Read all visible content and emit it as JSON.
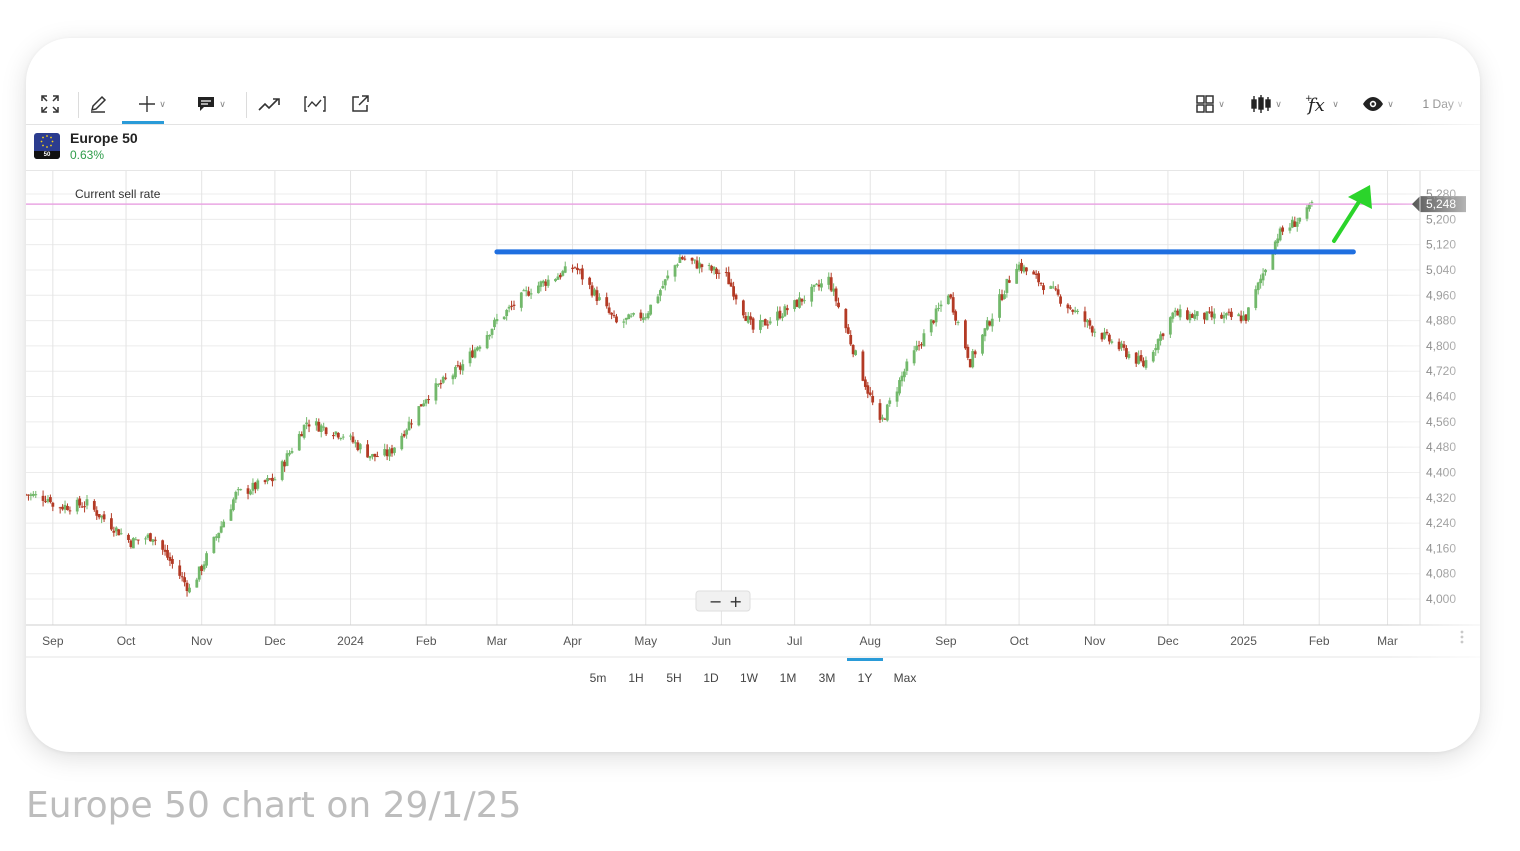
{
  "toolbar": {
    "tools_left": [
      "expand-icon",
      "pencil-icon",
      "crosshair-icon",
      "comment-icon",
      "trend-icon",
      "indicator-icon",
      "popout-icon"
    ],
    "tools_right": [
      "layout-grid-icon",
      "candles-icon",
      "function-icon",
      "eye-icon"
    ],
    "interval": "1 Day"
  },
  "instrument": {
    "name": "Europe 50",
    "change": "0.63%",
    "flag_tag": "50",
    "change_color": "#2e9c4a"
  },
  "chart_data": {
    "type": "candlestick",
    "title": "",
    "xlabel": "",
    "ylabel": "",
    "x_tick_labels": [
      "Sep",
      "Oct",
      "Nov",
      "Dec",
      "2024",
      "Feb",
      "Mar",
      "Apr",
      "May",
      "Jun",
      "Jul",
      "Aug",
      "Sep",
      "Oct",
      "Nov",
      "Dec",
      "2025",
      "Feb",
      "Mar"
    ],
    "y_tick_labels": [
      "4,000",
      "4,080",
      "4,160",
      "4,240",
      "4,320",
      "4,400",
      "4,480",
      "4,560",
      "4,640",
      "4,720",
      "4,800",
      "4,880",
      "4,960",
      "5,040",
      "5,120",
      "5,200",
      "5,280"
    ],
    "ylim": [
      3920,
      5330
    ],
    "grid": true,
    "up_color": "#72b86b",
    "down_color": "#b33a25",
    "key_levels": [
      {
        "date": "2023-09-01",
        "close": 4290
      },
      {
        "date": "2023-09-15",
        "close": 4300
      },
      {
        "date": "2023-10-03",
        "close": 4180
      },
      {
        "date": "2023-10-12",
        "close": 4200
      },
      {
        "date": "2023-10-27",
        "close": 4030
      },
      {
        "date": "2023-11-01",
        "close": 4100
      },
      {
        "date": "2023-11-15",
        "close": 4330
      },
      {
        "date": "2023-12-01",
        "close": 4380
      },
      {
        "date": "2023-12-14",
        "close": 4560
      },
      {
        "date": "2023-12-29",
        "close": 4520
      },
      {
        "date": "2024-01-10",
        "close": 4450
      },
      {
        "date": "2024-01-17",
        "close": 4460
      },
      {
        "date": "2024-02-01",
        "close": 4640
      },
      {
        "date": "2024-02-15",
        "close": 4730
      },
      {
        "date": "2024-03-01",
        "close": 4880
      },
      {
        "date": "2024-03-15",
        "close": 4980
      },
      {
        "date": "2024-04-02",
        "close": 5050
      },
      {
        "date": "2024-04-19",
        "close": 4870
      },
      {
        "date": "2024-05-01",
        "close": 4900
      },
      {
        "date": "2024-05-15",
        "close": 5080
      },
      {
        "date": "2024-06-03",
        "close": 5020
      },
      {
        "date": "2024-06-14",
        "close": 4850
      },
      {
        "date": "2024-07-01",
        "close": 4930
      },
      {
        "date": "2024-07-15",
        "close": 5010
      },
      {
        "date": "2024-08-05",
        "close": 4550
      },
      {
        "date": "2024-08-15",
        "close": 4720
      },
      {
        "date": "2024-09-02",
        "close": 4970
      },
      {
        "date": "2024-09-11",
        "close": 4750
      },
      {
        "date": "2024-09-30",
        "close": 5060
      },
      {
        "date": "2024-10-15",
        "close": 4970
      },
      {
        "date": "2024-11-01",
        "close": 4850
      },
      {
        "date": "2024-11-21",
        "close": 4740
      },
      {
        "date": "2024-12-03",
        "close": 4900
      },
      {
        "date": "2024-12-20",
        "close": 4890
      },
      {
        "date": "2025-01-02",
        "close": 4890
      },
      {
        "date": "2025-01-15",
        "close": 5150
      },
      {
        "date": "2025-01-27",
        "close": 5220
      },
      {
        "date": "2025-01-29",
        "close": 5248
      }
    ],
    "resistance_line": {
      "start_date": "2024-03-01",
      "end_date": "2025-02-15",
      "value": 5097,
      "color": "#1f6fe0"
    },
    "current_sell_rate": {
      "label": "Current sell rate",
      "value": 5248,
      "display": "5,248",
      "color": "#e9a6e3"
    },
    "annotation_arrow": {
      "color": "#2bd42b",
      "direction": "up-right"
    }
  },
  "zoom": {
    "minus": "−",
    "plus": "+"
  },
  "ranges": [
    "5m",
    "1H",
    "5H",
    "1D",
    "1W",
    "1M",
    "3M",
    "1Y",
    "Max"
  ],
  "active_range": "1Y",
  "caption": "Europe 50 chart on 29/1/25"
}
